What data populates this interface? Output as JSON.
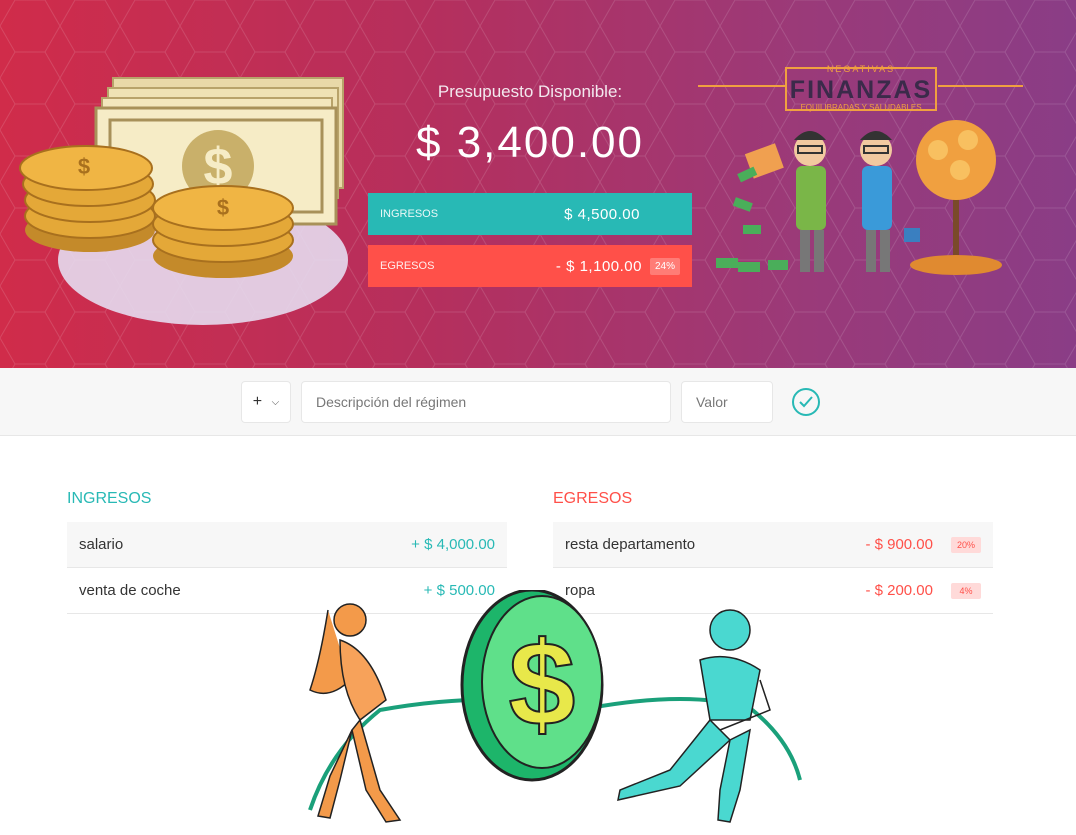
{
  "budget": {
    "title": "Presupuesto Disponible:",
    "value": "$ 3,400.00",
    "income_label": "Ingresos",
    "income_value": "$ 4,500.00",
    "expense_label": "Egresos",
    "expense_value": "- $ 1,100.00",
    "expense_percent": "24%"
  },
  "logo": {
    "top": "NEGATIVAS",
    "main": "FINANZAS",
    "bottom": "EQUILIBRADAS Y SALUDABLES"
  },
  "add": {
    "type_value": "+",
    "description_placeholder": "Descripción del régimen",
    "value_placeholder": "Valor"
  },
  "income": {
    "title": "Ingresos",
    "items": [
      {
        "description": "salario",
        "value": "+ $ 4,000.00"
      },
      {
        "description": "venta de coche",
        "value": "+ $ 500.00"
      }
    ]
  },
  "expenses": {
    "title": "Egresos",
    "items": [
      {
        "description": "resta departamento",
        "value": "- $ 900.00",
        "percent": "20%"
      },
      {
        "description": "ropa",
        "value": "- $ 200.00",
        "percent": "4%"
      }
    ]
  },
  "colors": {
    "income": "#28b9b5",
    "expense": "#ff5049",
    "banner_start": "#d02c4a",
    "banner_end": "#8a3d86"
  },
  "icons": [
    "money-stack-icon",
    "chevron-down-icon",
    "check-icon",
    "finance-people-illustration",
    "tug-of-war-illustration"
  ]
}
